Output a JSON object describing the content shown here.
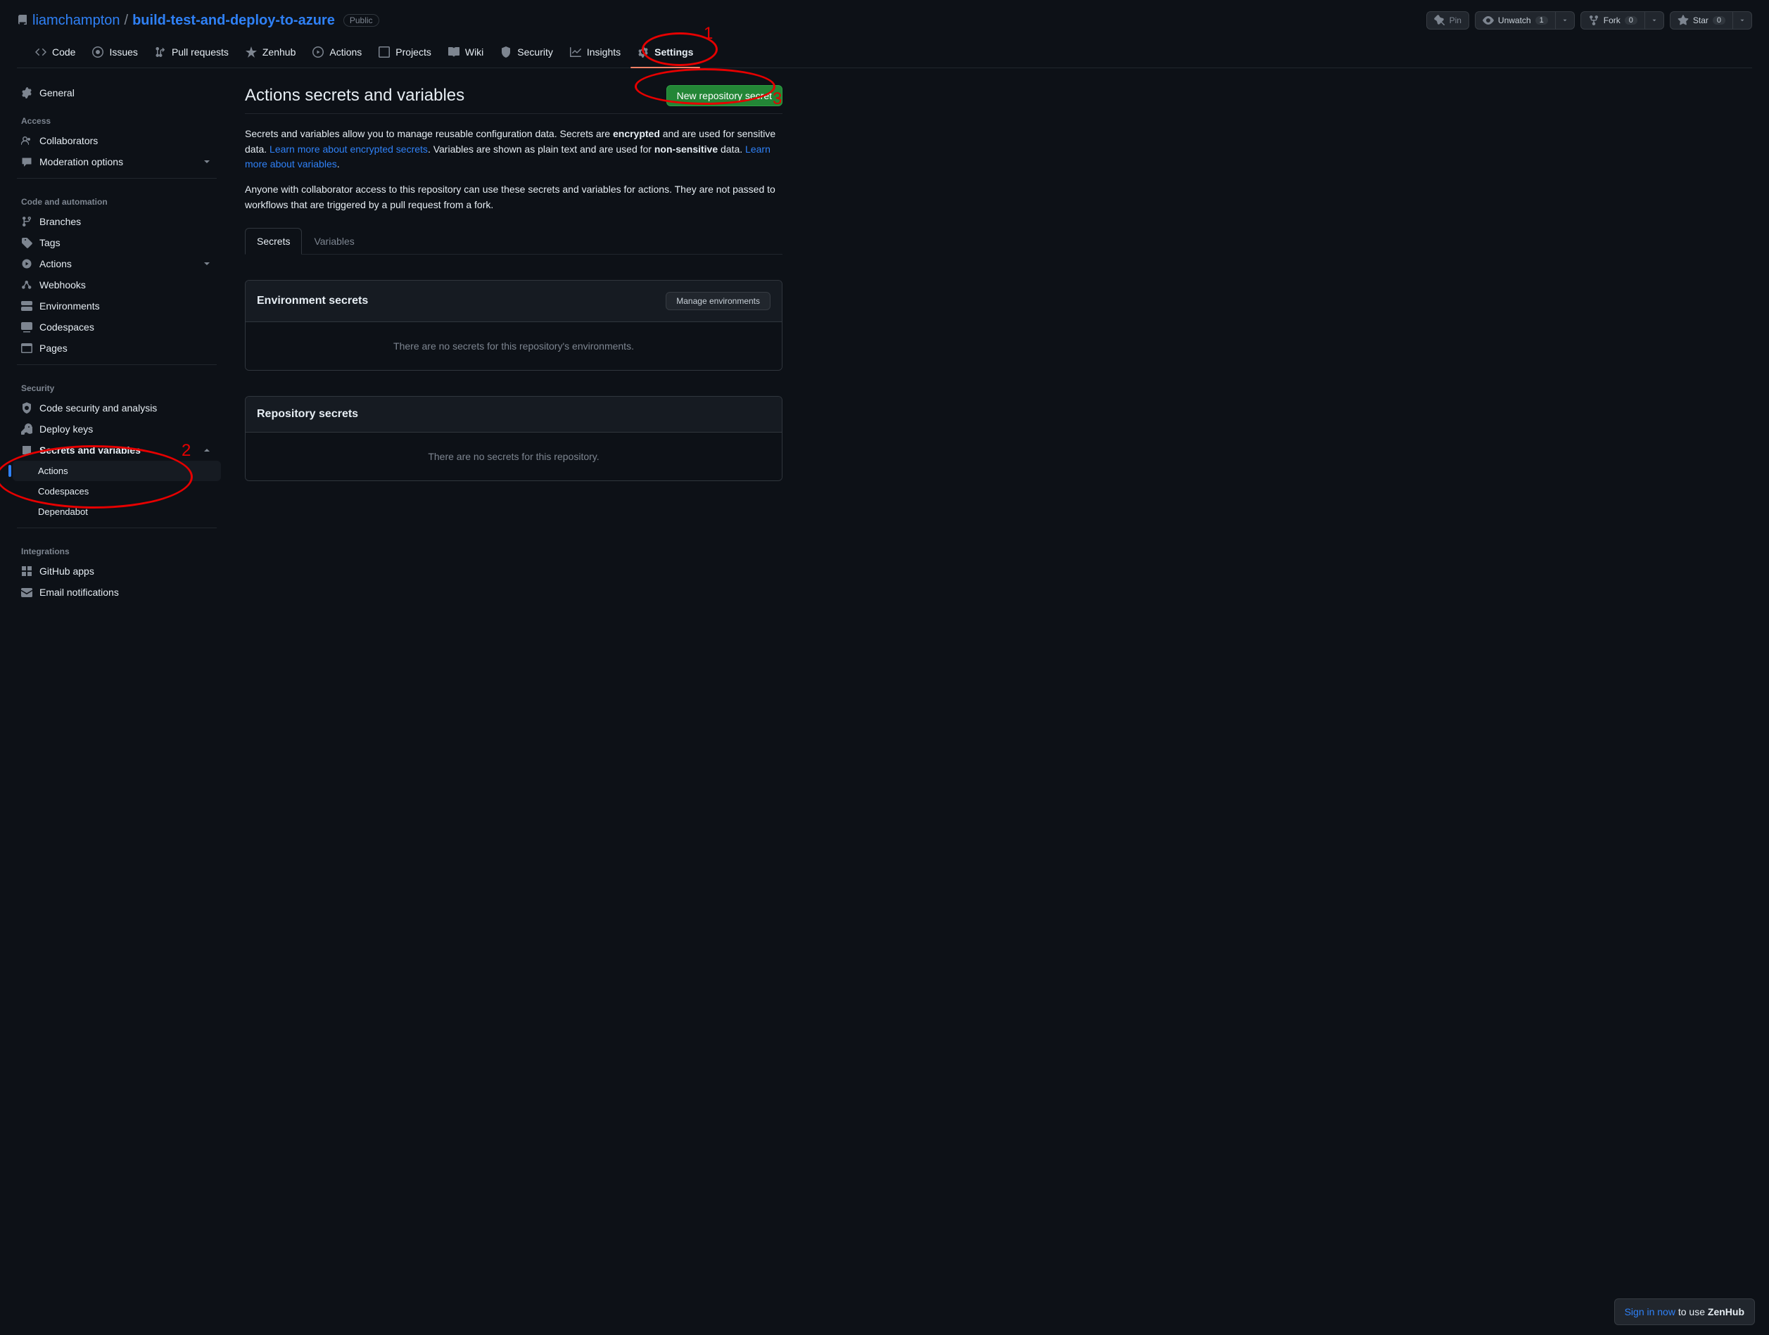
{
  "repo": {
    "owner": "liamchampton",
    "name": "build-test-and-deploy-to-azure",
    "visibility": "Public"
  },
  "repoActions": {
    "pin": "Pin",
    "watch": "Unwatch",
    "watchCount": "1",
    "fork": "Fork",
    "forkCount": "0",
    "star": "Star",
    "starCount": "0"
  },
  "tabs": {
    "code": "Code",
    "issues": "Issues",
    "pulls": "Pull requests",
    "zenhub": "Zenhub",
    "actions": "Actions",
    "projects": "Projects",
    "wiki": "Wiki",
    "security": "Security",
    "insights": "Insights",
    "settings": "Settings"
  },
  "sidebar": {
    "general": "General",
    "accessHeading": "Access",
    "collaborators": "Collaborators",
    "moderation": "Moderation options",
    "codeHeading": "Code and automation",
    "branches": "Branches",
    "tags": "Tags",
    "actions": "Actions",
    "webhooks": "Webhooks",
    "environments": "Environments",
    "codespaces": "Codespaces",
    "pages": "Pages",
    "securityHeading": "Security",
    "codeSecurity": "Code security and analysis",
    "deployKeys": "Deploy keys",
    "secretsVars": "Secrets and variables",
    "subActions": "Actions",
    "subCodespaces": "Codespaces",
    "subDependabot": "Dependabot",
    "integrationsHeading": "Integrations",
    "githubApps": "GitHub apps",
    "emailNotifications": "Email notifications"
  },
  "page": {
    "title": "Actions secrets and variables",
    "newSecretBtn": "New repository secret",
    "desc1a": "Secrets and variables allow you to manage reusable configuration data. Secrets are ",
    "desc1b": "encrypted",
    "desc1c": " and are used for sensitive data. ",
    "linkSecrets": "Learn more about encrypted secrets",
    "desc1d": ". Variables are shown as plain text and are used for ",
    "desc1e": "non-sensitive",
    "desc1f": " data. ",
    "linkVars": "Learn more about variables",
    "desc1g": ".",
    "desc2": "Anyone with collaborator access to this repository can use these secrets and variables for actions. They are not passed to workflows that are triggered by a pull request from a fork.",
    "subTabSecrets": "Secrets",
    "subTabVariables": "Variables",
    "envTitle": "Environment secrets",
    "manageEnvBtn": "Manage environments",
    "envEmpty": "There are no secrets for this repository's environments.",
    "repoSecretsTitle": "Repository secrets",
    "repoSecretsEmpty": "There are no secrets for this repository."
  },
  "annotations": {
    "n1": "1",
    "n2": "2",
    "n3": "3"
  },
  "toast": {
    "signIn": "Sign in now",
    "rest": " to use ",
    "brand": "ZenHub"
  }
}
